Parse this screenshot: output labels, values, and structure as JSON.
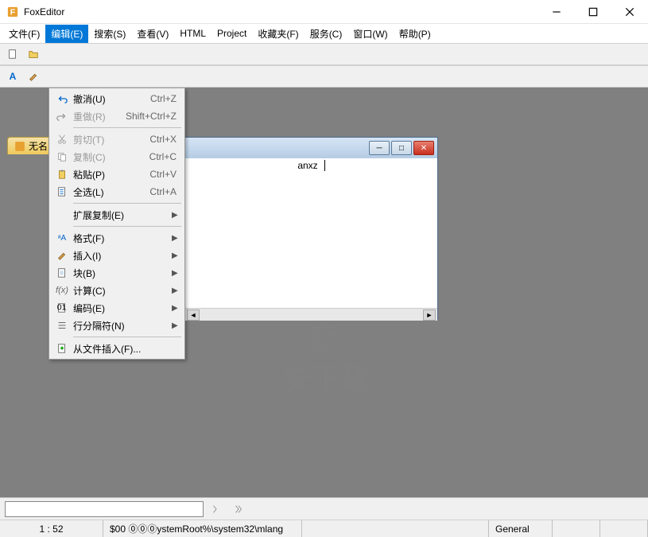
{
  "title": "FoxEditor",
  "menubar": [
    "文件(F)",
    "编辑(E)",
    "搜索(S)",
    "查看(V)",
    "HTML",
    "Project",
    "收藏夹(F)",
    "服务(C)",
    "窗口(W)",
    "帮助(P)"
  ],
  "dropdown": {
    "items": [
      {
        "icon": "undo",
        "label": "撤消(U)",
        "shortcut": "Ctrl+Z",
        "disabled": false
      },
      {
        "icon": "redo",
        "label": "重做(R)",
        "shortcut": "Shift+Ctrl+Z",
        "disabled": true
      },
      {
        "sep": true
      },
      {
        "icon": "cut",
        "label": "剪切(T)",
        "shortcut": "Ctrl+X",
        "disabled": true
      },
      {
        "icon": "copy",
        "label": "复制(C)",
        "shortcut": "Ctrl+C",
        "disabled": true
      },
      {
        "icon": "paste",
        "label": "粘贴(P)",
        "shortcut": "Ctrl+V",
        "disabled": false
      },
      {
        "icon": "selectall",
        "label": "全选(L)",
        "shortcut": "Ctrl+A",
        "disabled": false
      },
      {
        "sep": true
      },
      {
        "icon": "",
        "label": "扩展复制(E)",
        "shortcut": "",
        "arrow": true
      },
      {
        "sep": true
      },
      {
        "icon": "format",
        "label": "格式(F)",
        "shortcut": "",
        "arrow": true
      },
      {
        "icon": "insert",
        "label": "插入(I)",
        "shortcut": "",
        "arrow": true
      },
      {
        "icon": "block",
        "label": "块(B)",
        "shortcut": "",
        "arrow": true
      },
      {
        "icon": "calc",
        "label": "计算(C)",
        "shortcut": "",
        "arrow": true
      },
      {
        "icon": "encoding",
        "label": "编码(E)",
        "shortcut": "",
        "arrow": true
      },
      {
        "icon": "linesep",
        "label": "行分隔符(N)",
        "shortcut": "",
        "arrow": true
      },
      {
        "sep": true
      },
      {
        "icon": "fileinsert",
        "label": "从文件插入(F)...",
        "shortcut": "",
        "disabled": false
      }
    ]
  },
  "doc_tab": "无名",
  "child": {
    "text": "anxz"
  },
  "watermark": {
    "main": "安下载",
    "sub": "anxz.com"
  },
  "status": {
    "pos": "1 : 52",
    "path": "$00 ⓪⓪⓪ystemRoot%\\system32\\mlang",
    "mode": "General"
  }
}
